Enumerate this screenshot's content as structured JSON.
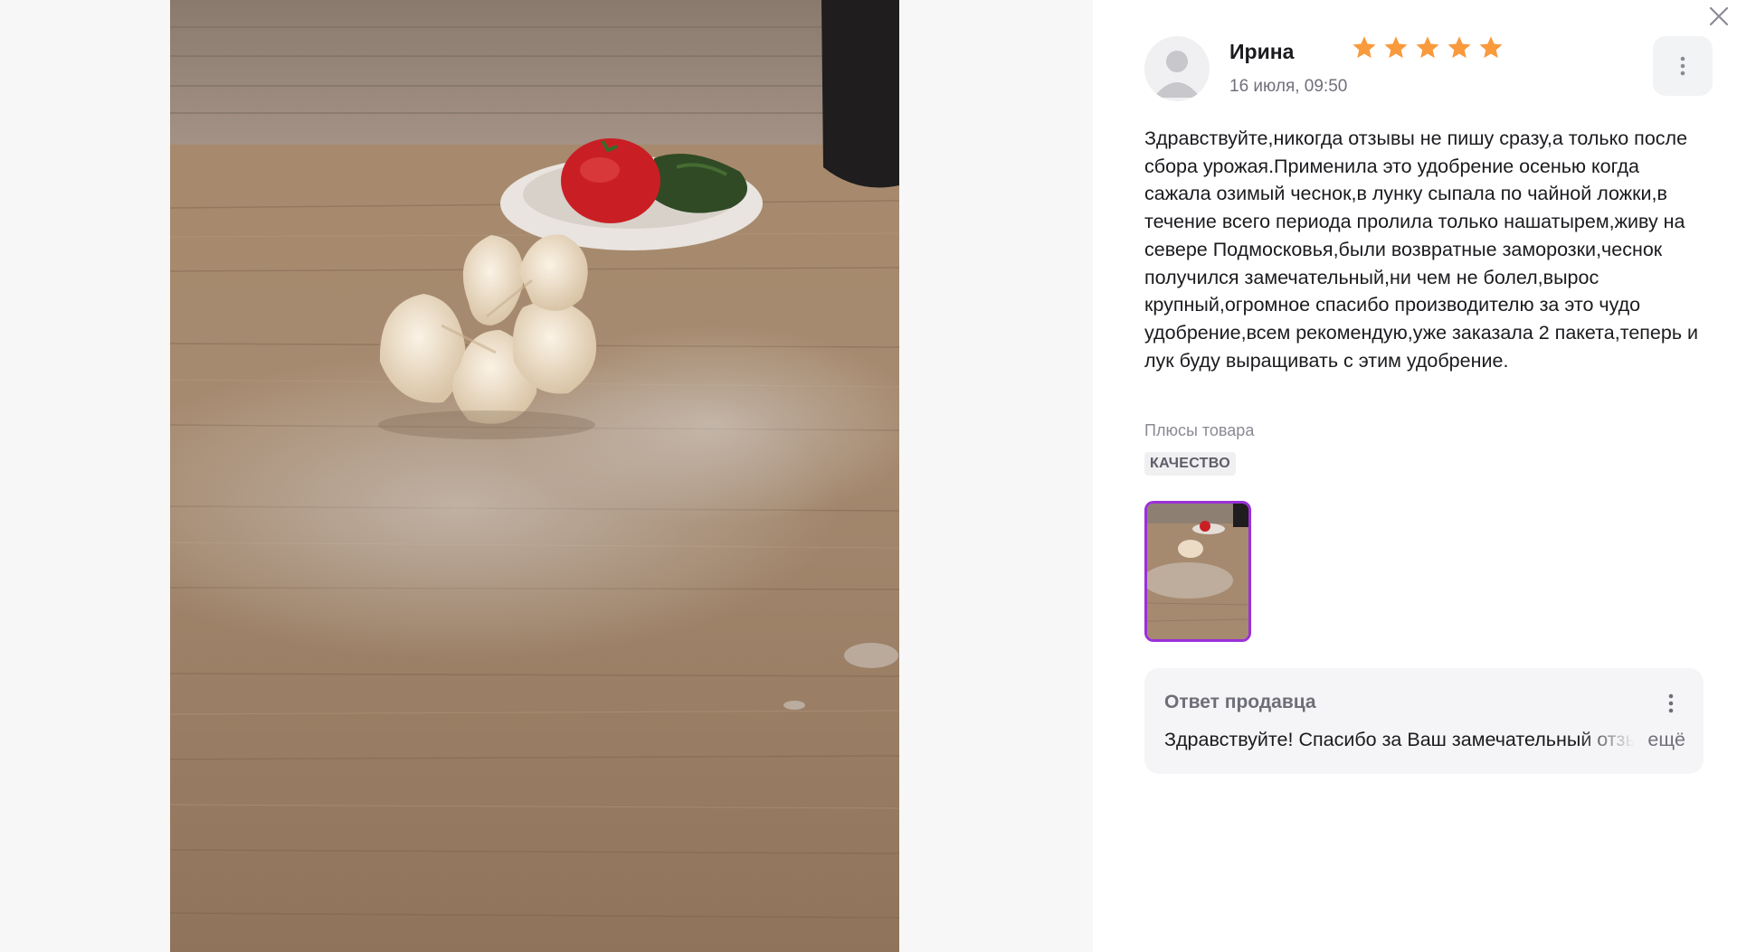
{
  "review": {
    "author": "Ирина",
    "rating": 5,
    "rating_max": 5,
    "date": "16 июля, 09:50",
    "text": "Здравствуйте,никогда отзывы не пишу сразу,а только после сбора урожая.Применила это удобрение осенью когда сажала озимый чеснок,в лунку сыпала по чайной ложки,в течение всего периода пролила только нашатырем,живу на севере Подмосковья,были возвратные заморозки,чеснок получился замечательный,ни чем не болел,вырос крупный,огромное спасибо производителю за это чудо удобрение,всем рекомендую,уже заказала 2 пакета,теперь и лук буду выращивать с этим удобрение.",
    "pros_label": "Плюсы товара",
    "pros_tags": [
      "КАЧЕСТВО"
    ]
  },
  "seller_answer": {
    "title": "Ответ продавца",
    "text": "Здравствуйте! Спасибо за Ваш замечательный отзыв",
    "more_label": "ещё"
  },
  "icons": {
    "close": "close-icon",
    "menu": "more-vertical-icon",
    "star": "star-icon",
    "avatar": "user-avatar-icon"
  },
  "colors": {
    "star": "#f99a3d",
    "thumb_border_active": "#9b30d9",
    "panel_bg": "#ffffff",
    "viewer_bg": "#f7f7f8"
  }
}
